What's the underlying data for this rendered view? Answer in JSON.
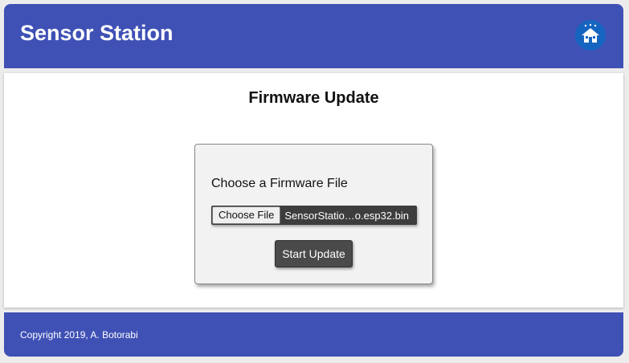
{
  "header": {
    "title": "Sensor Station",
    "home_icon": "home-icon"
  },
  "main": {
    "page_title": "Firmware Update",
    "form": {
      "label": "Choose a Firmware File",
      "choose_file_label": "Choose File",
      "selected_file": "SensorStatio…o.esp32.bin",
      "submit_label": "Start Update"
    }
  },
  "footer": {
    "copyright": "Copyright 2019, A. Botorabi"
  },
  "colors": {
    "brand": "#3f51b5",
    "button": "#4a4a4a",
    "card": "#f2f2f2"
  }
}
